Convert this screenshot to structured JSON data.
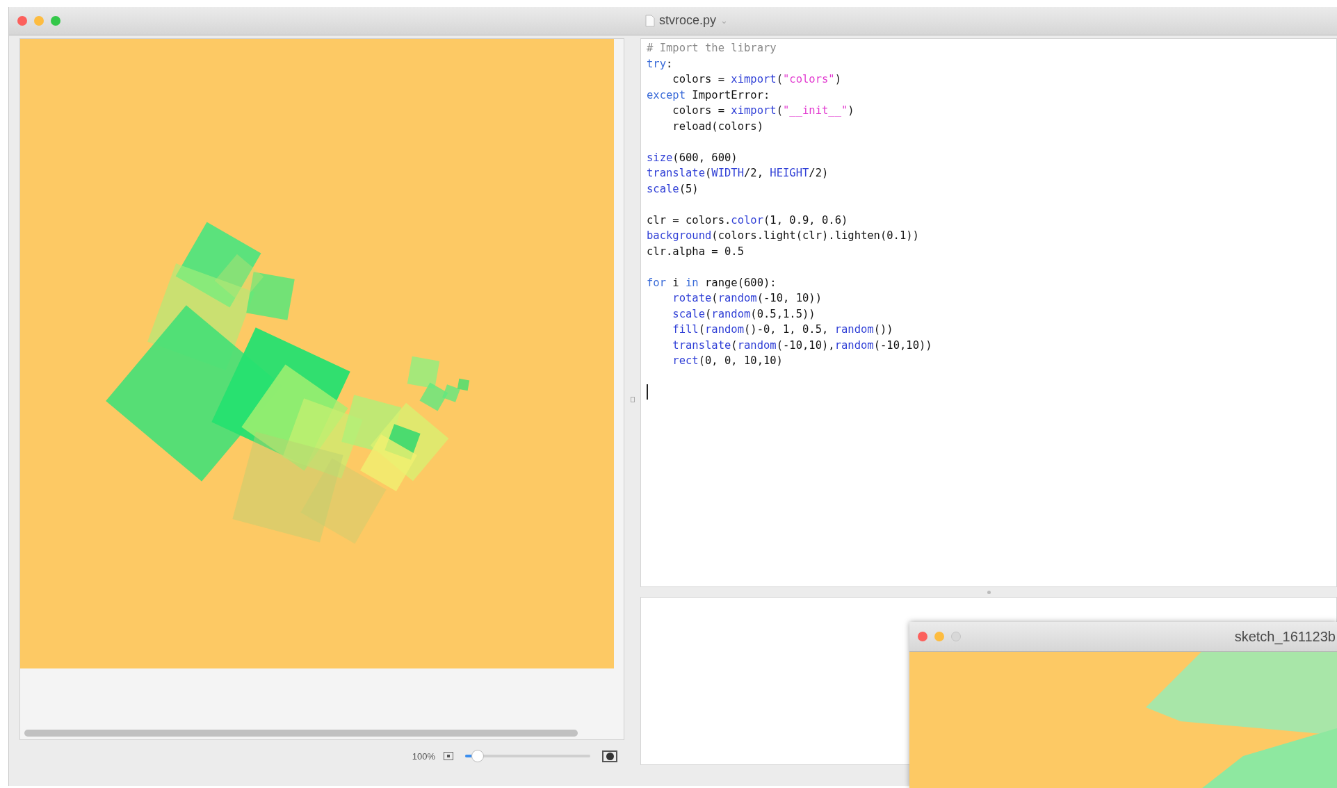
{
  "window": {
    "title": "stvroce.py",
    "dropdown": "⌄"
  },
  "code": {
    "paragraphs": [
      [
        {
          "tokens": [
            {
              "text": "# Import the library",
              "kind": "comment"
            }
          ]
        },
        {
          "tokens": [
            {
              "text": "try",
              "kind": "keyword"
            },
            {
              "text": ":",
              "kind": "plain"
            }
          ]
        },
        {
          "indent": true,
          "tokens": [
            {
              "text": "colors = ",
              "kind": "plain"
            },
            {
              "text": "ximport",
              "kind": "func"
            },
            {
              "text": "(",
              "kind": "plain"
            },
            {
              "text": "\"colors\"",
              "kind": "string"
            },
            {
              "text": ")",
              "kind": "plain"
            }
          ]
        },
        {
          "tokens": [
            {
              "text": "except",
              "kind": "keyword"
            },
            {
              "text": " ImportError:",
              "kind": "plain"
            }
          ]
        },
        {
          "indent": true,
          "tokens": [
            {
              "text": "colors = ",
              "kind": "plain"
            },
            {
              "text": "ximport",
              "kind": "func"
            },
            {
              "text": "(",
              "kind": "plain"
            },
            {
              "text": "\"__init__\"",
              "kind": "string"
            },
            {
              "text": ")",
              "kind": "plain"
            }
          ]
        },
        {
          "indent": true,
          "tokens": [
            {
              "text": "reload(colors)",
              "kind": "plain"
            }
          ]
        }
      ],
      [
        {
          "tokens": [
            {
              "text": "size",
              "kind": "func"
            },
            {
              "text": "(600, 600)",
              "kind": "plain"
            }
          ]
        },
        {
          "tokens": [
            {
              "text": "translate",
              "kind": "func"
            },
            {
              "text": "(",
              "kind": "plain"
            },
            {
              "text": "WIDTH",
              "kind": "func"
            },
            {
              "text": "/2, ",
              "kind": "plain"
            },
            {
              "text": "HEIGHT",
              "kind": "func"
            },
            {
              "text": "/2)",
              "kind": "plain"
            }
          ]
        },
        {
          "tokens": [
            {
              "text": "scale",
              "kind": "func"
            },
            {
              "text": "(5)",
              "kind": "plain"
            }
          ]
        }
      ],
      [
        {
          "tokens": [
            {
              "text": "clr = colors.",
              "kind": "plain"
            },
            {
              "text": "color",
              "kind": "func"
            },
            {
              "text": "(1, 0.9, 0.6)",
              "kind": "plain"
            }
          ]
        },
        {
          "tokens": [
            {
              "text": "background",
              "kind": "func"
            },
            {
              "text": "(colors.light(clr).lighten(0.1))",
              "kind": "plain"
            }
          ]
        },
        {
          "tokens": [
            {
              "text": "clr.alpha = 0.5",
              "kind": "plain"
            }
          ]
        }
      ],
      [
        {
          "tokens": [
            {
              "text": "for",
              "kind": "keyword"
            },
            {
              "text": " i ",
              "kind": "plain"
            },
            {
              "text": "in",
              "kind": "keyword"
            },
            {
              "text": " range(600):",
              "kind": "plain"
            }
          ]
        },
        {
          "indent": true,
          "tokens": [
            {
              "text": "rotate",
              "kind": "func"
            },
            {
              "text": "(",
              "kind": "plain"
            },
            {
              "text": "random",
              "kind": "func"
            },
            {
              "text": "(-10, 10))",
              "kind": "plain"
            }
          ]
        },
        {
          "indent": true,
          "tokens": [
            {
              "text": "scale",
              "kind": "func"
            },
            {
              "text": "(",
              "kind": "plain"
            },
            {
              "text": "random",
              "kind": "func"
            },
            {
              "text": "(0.5,1.5))",
              "kind": "plain"
            }
          ]
        },
        {
          "indent": true,
          "tokens": [
            {
              "text": "fill",
              "kind": "func"
            },
            {
              "text": "(",
              "kind": "plain"
            },
            {
              "text": "random",
              "kind": "func"
            },
            {
              "text": "()-0, 1, 0.5, ",
              "kind": "plain"
            },
            {
              "text": "random",
              "kind": "func"
            },
            {
              "text": "())",
              "kind": "plain"
            }
          ]
        },
        {
          "indent": true,
          "tokens": [
            {
              "text": "translate",
              "kind": "func"
            },
            {
              "text": "(",
              "kind": "plain"
            },
            {
              "text": "random",
              "kind": "func"
            },
            {
              "text": "(-10,10),",
              "kind": "plain"
            },
            {
              "text": "random",
              "kind": "func"
            },
            {
              "text": "(-10,10))",
              "kind": "plain"
            }
          ]
        },
        {
          "indent": true,
          "tokens": [
            {
              "text": "rect",
              "kind": "func"
            },
            {
              "text": "(0, 0, 10,10)",
              "kind": "plain"
            }
          ]
        }
      ]
    ]
  },
  "zoom": {
    "label": "100%",
    "level": 0.1
  },
  "sketch_window": {
    "title": "sketch_161123b"
  }
}
